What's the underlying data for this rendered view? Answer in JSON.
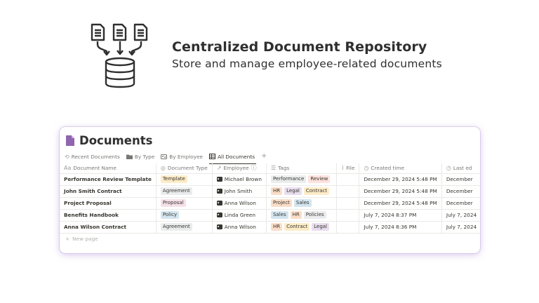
{
  "hero": {
    "title": "Centralized Document Repository",
    "subtitle": "Store and manage employee-related documents",
    "graphic_icon": "documents-to-database-icon"
  },
  "database": {
    "title": "Documents",
    "title_icon": "page-icon",
    "accent": "#9065b0",
    "tabs": [
      {
        "label": "Recent Documents",
        "icon": "history-icon",
        "active": false
      },
      {
        "label": "By Type",
        "icon": "folder-icon",
        "active": false
      },
      {
        "label": "By Employee",
        "icon": "contact-card-icon",
        "active": false
      },
      {
        "label": "All Documents",
        "icon": "table-icon",
        "active": true
      }
    ],
    "add_tab": "+",
    "columns": [
      {
        "label": "Document Name",
        "icon": "Aa"
      },
      {
        "label": "Document Type",
        "icon": "◎"
      },
      {
        "label": "Employee",
        "icon": "↗",
        "suffix": "ⓘ"
      },
      {
        "label": "Tags",
        "icon": "☰"
      },
      {
        "label": "File",
        "icon": "⌇"
      },
      {
        "label": "Created time",
        "icon": "◷"
      },
      {
        "label": "Last ed",
        "icon": "◷"
      }
    ],
    "rows": [
      {
        "name": "Performance Review Template",
        "type": "Template",
        "employee": "Michael Brown",
        "tags": [
          "Performance",
          "Review"
        ],
        "file": "",
        "created": "December 29, 2024 5:48 PM",
        "last": "December"
      },
      {
        "name": "John Smith Contract",
        "type": "Agreement",
        "employee": "John Smith",
        "tags": [
          "HR",
          "Legal",
          "Contract"
        ],
        "file": "",
        "created": "December 29, 2024 5:48 PM",
        "last": "December"
      },
      {
        "name": "Project Proposal",
        "type": "Proposal",
        "employee": "Anna Wilson",
        "tags": [
          "Project",
          "Sales"
        ],
        "file": "",
        "created": "December 29, 2024 5:48 PM",
        "last": "December"
      },
      {
        "name": "Benefits Handbook",
        "type": "Policy",
        "employee": "Linda Green",
        "tags": [
          "Sales",
          "HR",
          "Policies"
        ],
        "file": "",
        "created": "July 7, 2024 8:37 PM",
        "last": "July 7, 2024"
      },
      {
        "name": "Anna Wilson Contract",
        "type": "Agreement",
        "employee": "Anna Wilson",
        "tags": [
          "HR",
          "Contract",
          "Legal"
        ],
        "file": "",
        "created": "July 7, 2024 8:36 PM",
        "last": "July 7, 2024"
      }
    ],
    "new_page_label": "New page",
    "tag_colors": {
      "Template": "#fdecc8",
      "Agreement": "#ebeced",
      "Proposal": "#f5e0e9",
      "Policy": "#d3e5ef",
      "Performance": "#ebeced",
      "Review": "#ffe2dd",
      "HR": "#fadec9",
      "Legal": "#e8deee",
      "Contract": "#fdecc8",
      "Project": "#fadec9",
      "Sales": "#d3e5ef",
      "Policies": "#ebeced"
    }
  }
}
